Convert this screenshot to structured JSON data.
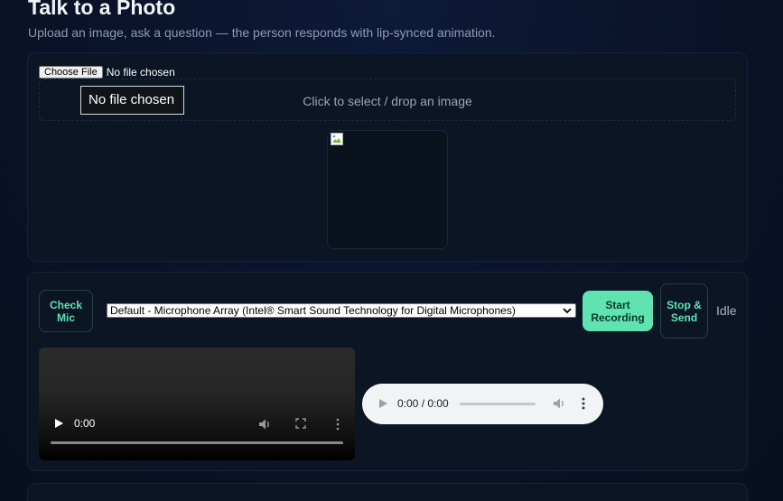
{
  "header": {
    "title": "Talk to a Photo",
    "subtitle": "Upload an image, ask a question — the person responds with lip-synced animation."
  },
  "upload": {
    "choose_file_label": "Choose File",
    "file_status": "No file chosen",
    "tooltip": "No file chosen",
    "dropzone_text": "Click to select / drop an image",
    "preview_icon": "broken-image-icon"
  },
  "recording": {
    "check_mic_label": "Check Mic",
    "mic_selected": "Default - Microphone Array (Intel® Smart Sound Technology for Digital Microphones)",
    "start_label": "Start Recording",
    "stop_label": "Stop & Send",
    "status": "Idle"
  },
  "video": {
    "time": "0:00"
  },
  "audio": {
    "time": "0:00 / 0:00"
  },
  "colors": {
    "accent": "#5fe3b0",
    "background": "#0a1228",
    "card": "#0c1524"
  }
}
